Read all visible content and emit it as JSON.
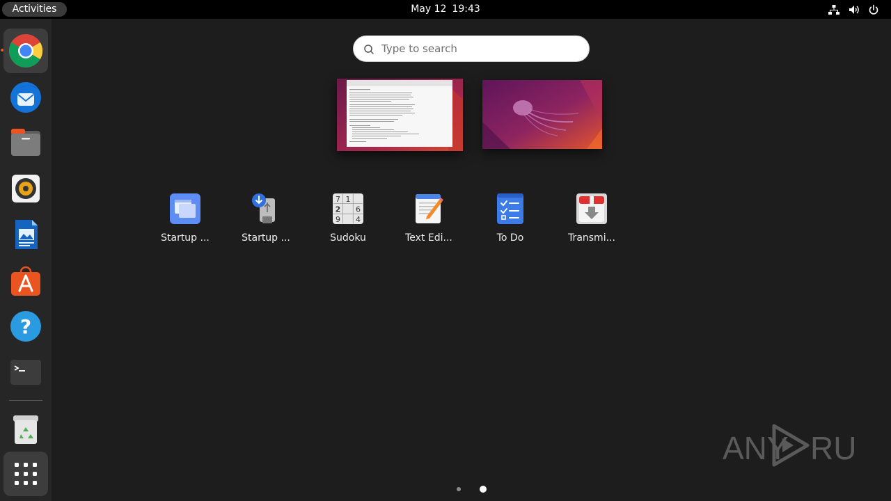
{
  "topbar": {
    "activities_label": "Activities",
    "date": "May 12",
    "time": "19:43",
    "tray_icons": [
      "network-icon",
      "volume-icon",
      "power-icon"
    ]
  },
  "dock": {
    "items": [
      {
        "name": "chrome",
        "icon": "chrome-icon",
        "running": true,
        "active": true
      },
      {
        "name": "thunderbird",
        "icon": "thunderbird-icon"
      },
      {
        "name": "files",
        "icon": "files-icon"
      },
      {
        "name": "rhythmbox",
        "icon": "rhythmbox-icon"
      },
      {
        "name": "libreoffice-writer",
        "icon": "writer-icon"
      },
      {
        "name": "app-center",
        "icon": "app-center-icon"
      },
      {
        "name": "help",
        "icon": "help-icon"
      },
      {
        "name": "terminal",
        "icon": "terminal-icon"
      },
      {
        "name": "trash",
        "icon": "trash-icon"
      },
      {
        "name": "show-apps",
        "icon": "app-grid-icon"
      }
    ]
  },
  "search": {
    "placeholder": "Type to search"
  },
  "apps": [
    {
      "label": "Startup ...",
      "icon": "startup-apps-icon"
    },
    {
      "label": "Startup ...",
      "icon": "startup-disk-creator-icon"
    },
    {
      "label": "Sudoku",
      "icon": "sudoku-icon"
    },
    {
      "label": "Text Edi...",
      "icon": "text-editor-icon"
    },
    {
      "label": "To Do",
      "icon": "todo-icon"
    },
    {
      "label": "Transmi...",
      "icon": "transmission-icon"
    }
  ],
  "pager": {
    "pages": 2,
    "current": 2
  },
  "watermark": {
    "text_left": "ANY",
    "text_right": "RUN"
  },
  "colors": {
    "topbar": "#000000",
    "dock": "#262626",
    "background": "#1d1d1d",
    "accent": "#e95420"
  }
}
